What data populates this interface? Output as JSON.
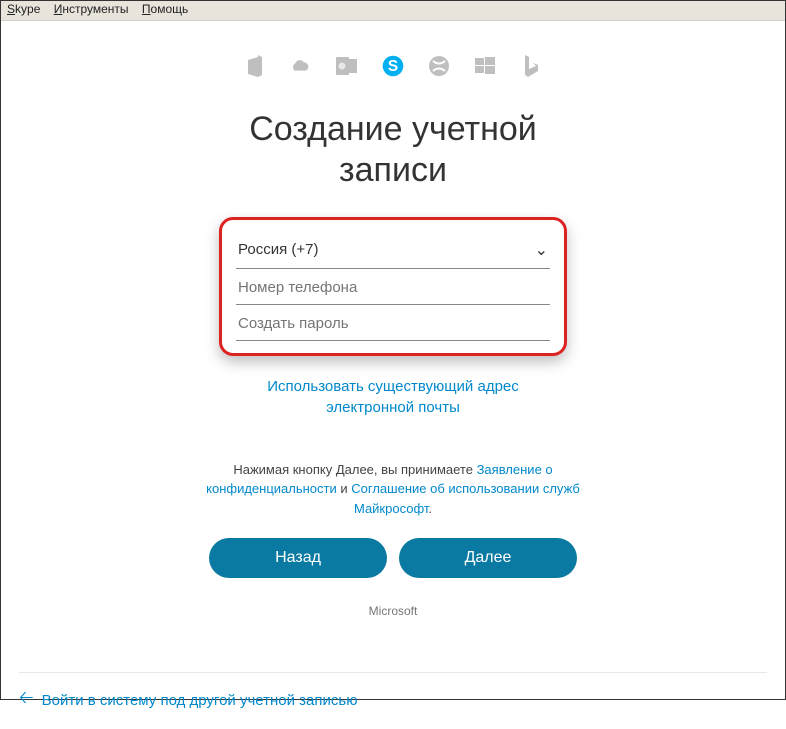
{
  "menubar": {
    "skype": "Skype",
    "tools": "Инструменты",
    "help": "Помощь"
  },
  "title_line1": "Создание учетной",
  "title_line2": "записи",
  "form": {
    "country_code": "Россия (+7)",
    "phone_placeholder": "Номер телефона",
    "password_placeholder": "Создать пароль"
  },
  "use_email_line1": "Использовать существующий адрес",
  "use_email_line2": "электронной почты",
  "terms": {
    "prefix": "Нажимая кнопку Далее, вы принимаете ",
    "privacy": "Заявление о конфиденциальности",
    "and": " и ",
    "agreement": "Соглашение об использовании служб Майкрософт",
    "suffix": "."
  },
  "buttons": {
    "back": "Назад",
    "next": "Далее"
  },
  "footer": "Microsoft",
  "bottom_link": "Войти в систему под другой учетной записью"
}
